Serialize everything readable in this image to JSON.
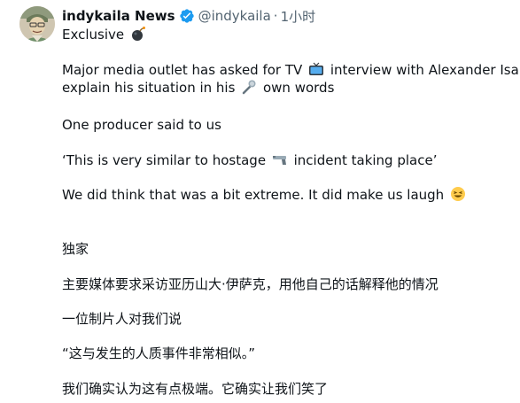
{
  "author": {
    "name": "indykaila News",
    "handle": "@indykaila",
    "separator": "·",
    "time": "1小时"
  },
  "tweet": {
    "line_exclusive": "Exclusive",
    "line_media_1a": "Major media outlet has asked for TV",
    "line_media_1b": "interview with Alexander Isak to",
    "line_media_2a": "explain his situation in his",
    "line_media_2b": "own words",
    "line_producer": "One producer said to us",
    "line_quote_a": "‘This is very similar to hostage",
    "line_quote_b": "incident taking place’",
    "line_extreme": "We did think that was a bit extreme. It did make us laugh",
    "zh_exclusive": "独家",
    "zh_media": "主要媒体要求采访亚历山大·伊萨克，用他自己的话解释他的情况",
    "zh_producer": "一位制片人对我们说",
    "zh_quote": "“这与发生的人质事件非常相似。”",
    "zh_extreme": "我们确实认为这有点极端。它确实让我们笑了"
  },
  "icons": {
    "verified_color": "#1d9bf0",
    "emoji_bomb": "bomb-icon",
    "emoji_tv": "television-icon",
    "emoji_mic": "microphone-icon",
    "emoji_gun": "pistol-icon",
    "emoji_laugh": "laughing-face-icon"
  }
}
